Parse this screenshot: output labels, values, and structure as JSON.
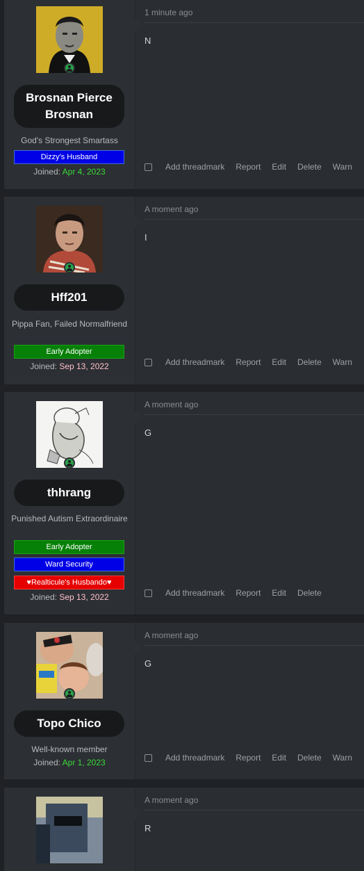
{
  "posts": [
    {
      "user": {
        "name": "Brosnan Pierce Brosnan",
        "title": "God's Strongest Smartass",
        "banners": [
          {
            "label": "Dizzy's Husband",
            "color": "#0000e6"
          }
        ],
        "joined_label": "Joined:",
        "joined_date": "Apr 4, 2023",
        "joined_color": "#39d939"
      },
      "time": "1 minute ago",
      "body": "N",
      "actions": [
        "Add threadmark",
        "Report",
        "Edit",
        "Delete",
        "Warn"
      ]
    },
    {
      "user": {
        "name": "Hff201",
        "title": "Pippa Fan, Failed Normalfriend",
        "banners": [
          {
            "label": "Early Adopter",
            "color": "#078007"
          }
        ],
        "joined_label": "Joined:",
        "joined_date": "Sep 13, 2022",
        "joined_color": "#ffc0cb"
      },
      "time": "A moment ago",
      "body": "I",
      "actions": [
        "Add threadmark",
        "Report",
        "Edit",
        "Delete",
        "Warn"
      ]
    },
    {
      "user": {
        "name": "thhrang",
        "title": "Punished Autism Extraordinaire",
        "banners": [
          {
            "label": "Early Adopter",
            "color": "#078007"
          },
          {
            "label": "Ward Security",
            "color": "#0000e6"
          },
          {
            "label": "♥Realticule's Husbando♥",
            "color": "#e60000"
          }
        ],
        "joined_label": "Joined:",
        "joined_date": "Sep 13, 2022",
        "joined_color": "#ffc0cb"
      },
      "time": "A moment ago",
      "body": "G",
      "actions": [
        "Add threadmark",
        "Report",
        "Edit",
        "Delete"
      ]
    },
    {
      "user": {
        "name": "Topo Chico",
        "title": "Well-known member",
        "banners": [],
        "joined_label": "Joined:",
        "joined_date": "Apr 1, 2023",
        "joined_color": "#39d939"
      },
      "time": "A moment ago",
      "body": "G",
      "actions": [
        "Add threadmark",
        "Report",
        "Edit",
        "Delete",
        "Warn"
      ]
    },
    {
      "user": {
        "name": "",
        "title": "",
        "banners": [],
        "joined_label": "",
        "joined_date": ""
      },
      "time": "A moment ago",
      "body": "R",
      "actions": []
    }
  ],
  "icons": {
    "online": "online-status-icon",
    "select": "checkbox-icon"
  }
}
